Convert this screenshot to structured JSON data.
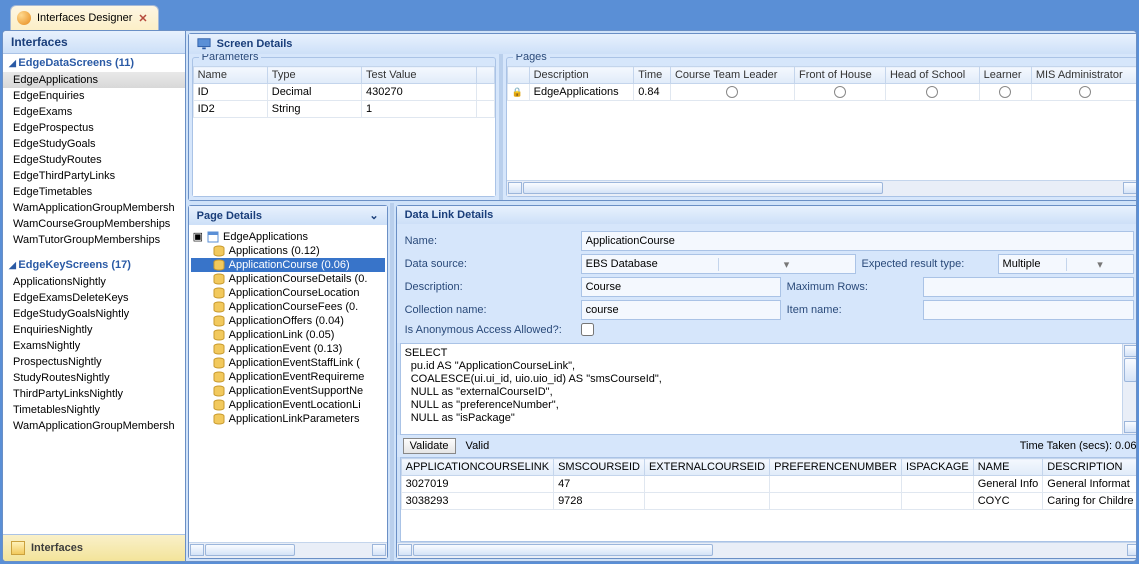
{
  "tab": {
    "title": "Interfaces Designer",
    "close": "✕"
  },
  "sidebar": {
    "header": "Interfaces",
    "section1": {
      "label": "EdgeDataScreens (11)",
      "items": [
        "EdgeApplications",
        "EdgeEnquiries",
        "EdgeExams",
        "EdgeProspectus",
        "EdgeStudyGoals",
        "EdgeStudyRoutes",
        "EdgeThirdPartyLinks",
        "EdgeTimetables",
        "WamApplicationGroupMembersh",
        "WamCourseGroupMemberships",
        "WamTutorGroupMemberships"
      ]
    },
    "section2": {
      "label": "EdgeKeyScreens (17)",
      "items": [
        "ApplicationsNightly",
        "EdgeExamsDeleteKeys",
        "EdgeStudyGoalsNightly",
        "EnquiriesNightly",
        "ExamsNightly",
        "ProspectusNightly",
        "StudyRoutesNightly",
        "ThirdPartyLinksNightly",
        "TimetablesNightly",
        "WamApplicationGroupMembersh"
      ]
    },
    "footer": "Interfaces"
  },
  "screen": {
    "header": "Screen Details",
    "params": {
      "legend": "Parameters",
      "cols": [
        "Name",
        "Type",
        "Test Value"
      ],
      "rows": [
        {
          "name": "ID",
          "type": "Decimal",
          "value": "430270"
        },
        {
          "name": "ID2",
          "type": "String",
          "value": "1"
        }
      ]
    },
    "pages": {
      "legend": "Pages",
      "cols": [
        "Description",
        "Time",
        "Course Team Leader",
        "Front of House",
        "Head of School",
        "Learner",
        "MIS Administrator"
      ],
      "rows": [
        {
          "desc": "EdgeApplications",
          "time": "0.84"
        }
      ]
    }
  },
  "pageDetails": {
    "header": "Page Details",
    "root": "EdgeApplications",
    "items": [
      "Applications (0.12)",
      "ApplicationCourse (0.06)",
      "ApplicationCourseDetails (0.",
      "ApplicationCourseLocation",
      "ApplicationCourseFees (0.",
      "ApplicationOffers (0.04)",
      "ApplicationLink (0.05)",
      "ApplicationEvent (0.13)",
      "ApplicationEventStaffLink (",
      "ApplicationEventRequireme",
      "ApplicationEventSupportNe",
      "ApplicationEventLocationLi",
      "ApplicationLinkParameters"
    ],
    "selectedIndex": 1
  },
  "dlink": {
    "header": "Data Link Details",
    "labels": {
      "name": "Name:",
      "dataSource": "Data source:",
      "expected": "Expected result type:",
      "description": "Description:",
      "maxRows": "Maximum Rows:",
      "collection": "Collection name:",
      "itemName": "Item name:",
      "anon": "Is Anonymous Access Allowed?:"
    },
    "values": {
      "name": "ApplicationCourse",
      "dataSource": "EBS Database",
      "expected": "Multiple",
      "description": "Course",
      "maxRows": "",
      "collection": "course",
      "itemName": ""
    },
    "sql": "SELECT\n  pu.id AS \"ApplicationCourseLink\",\n  COALESCE(ui.ui_id, uio.uio_id) AS \"smsCourseId\",\n  NULL as \"externalCourseID\",\n  NULL as \"preferenceNumber\",\n  NULL as \"isPackage\"",
    "validateBtn": "Validate",
    "validStatus": "Valid",
    "timeTaken": "Time Taken (secs): 0.06",
    "resultCols": [
      "APPLICATIONCOURSELINK",
      "SMSCOURSEID",
      "EXTERNALCOURSEID",
      "PREFERENCENUMBER",
      "ISPACKAGE",
      "NAME",
      "DESCRIPTION"
    ],
    "resultRows": [
      {
        "c0": "3027019",
        "c1": "47",
        "c2": "",
        "c3": "",
        "c4": "",
        "c5": "General Info",
        "c6": "General Informat"
      },
      {
        "c0": "3038293",
        "c1": "9728",
        "c2": "",
        "c3": "",
        "c4": "",
        "c5": "COYC",
        "c6": "Caring for Childre"
      }
    ]
  }
}
